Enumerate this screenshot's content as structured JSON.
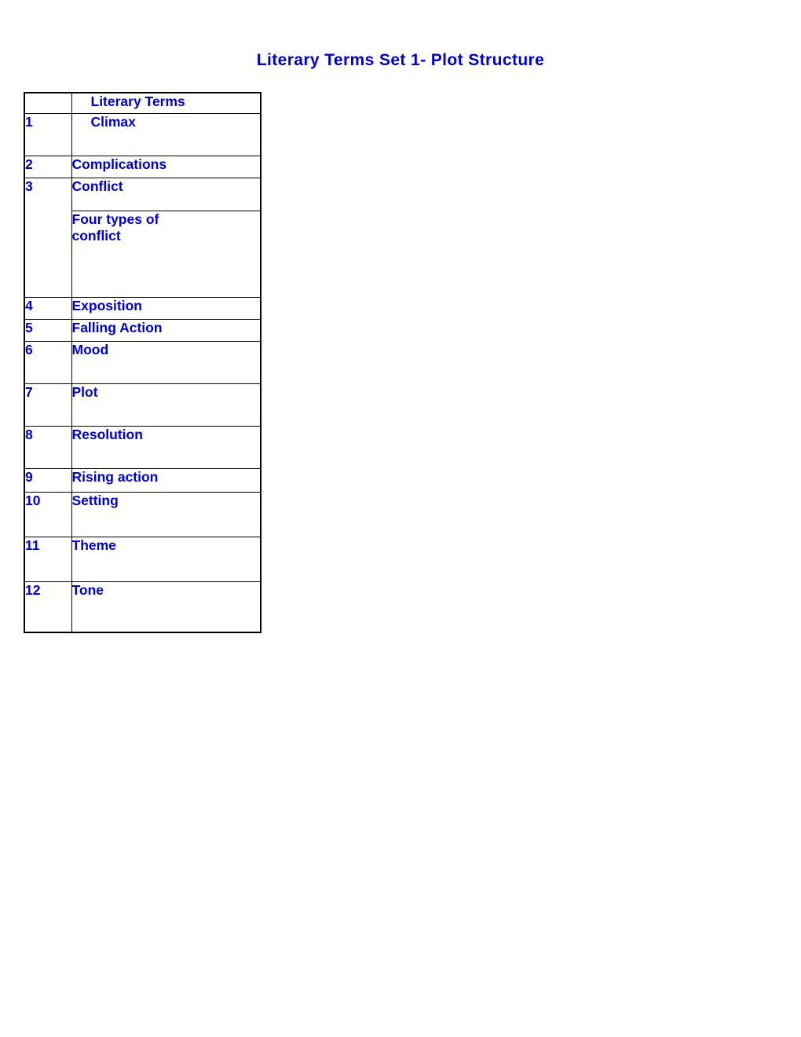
{
  "document": {
    "title": "Literary Terms Set 1- Plot Structure",
    "title_color": "#0000CC",
    "text_color": "#0000CC",
    "border_color": "#000000",
    "background": "#FFFFFF"
  },
  "table": {
    "header": {
      "num_label": "",
      "term_label": "Literary Terms"
    },
    "rows": [
      {
        "num": "1",
        "term": "Climax",
        "term2": ""
      },
      {
        "num": "2",
        "term": "Complications",
        "term2": ""
      },
      {
        "num": "3",
        "term": "Conflict",
        "term2_line1": "Four types of",
        "term2_line2": "conflict"
      },
      {
        "num": "4",
        "term": "Exposition",
        "term2": ""
      },
      {
        "num": "5",
        "term": "Falling Action",
        "term2": ""
      },
      {
        "num": "6",
        "term": "Mood",
        "term2": ""
      },
      {
        "num": "7",
        "term": "Plot",
        "term2": ""
      },
      {
        "num": "8",
        "term": "Resolution",
        "term2": ""
      },
      {
        "num": "9",
        "term": "Rising action",
        "term2": ""
      },
      {
        "num": "10",
        "term": "Setting",
        "term2": ""
      },
      {
        "num": "11",
        "term": "Theme",
        "term2": ""
      },
      {
        "num": "12",
        "term": "Tone",
        "term2": ""
      }
    ]
  }
}
